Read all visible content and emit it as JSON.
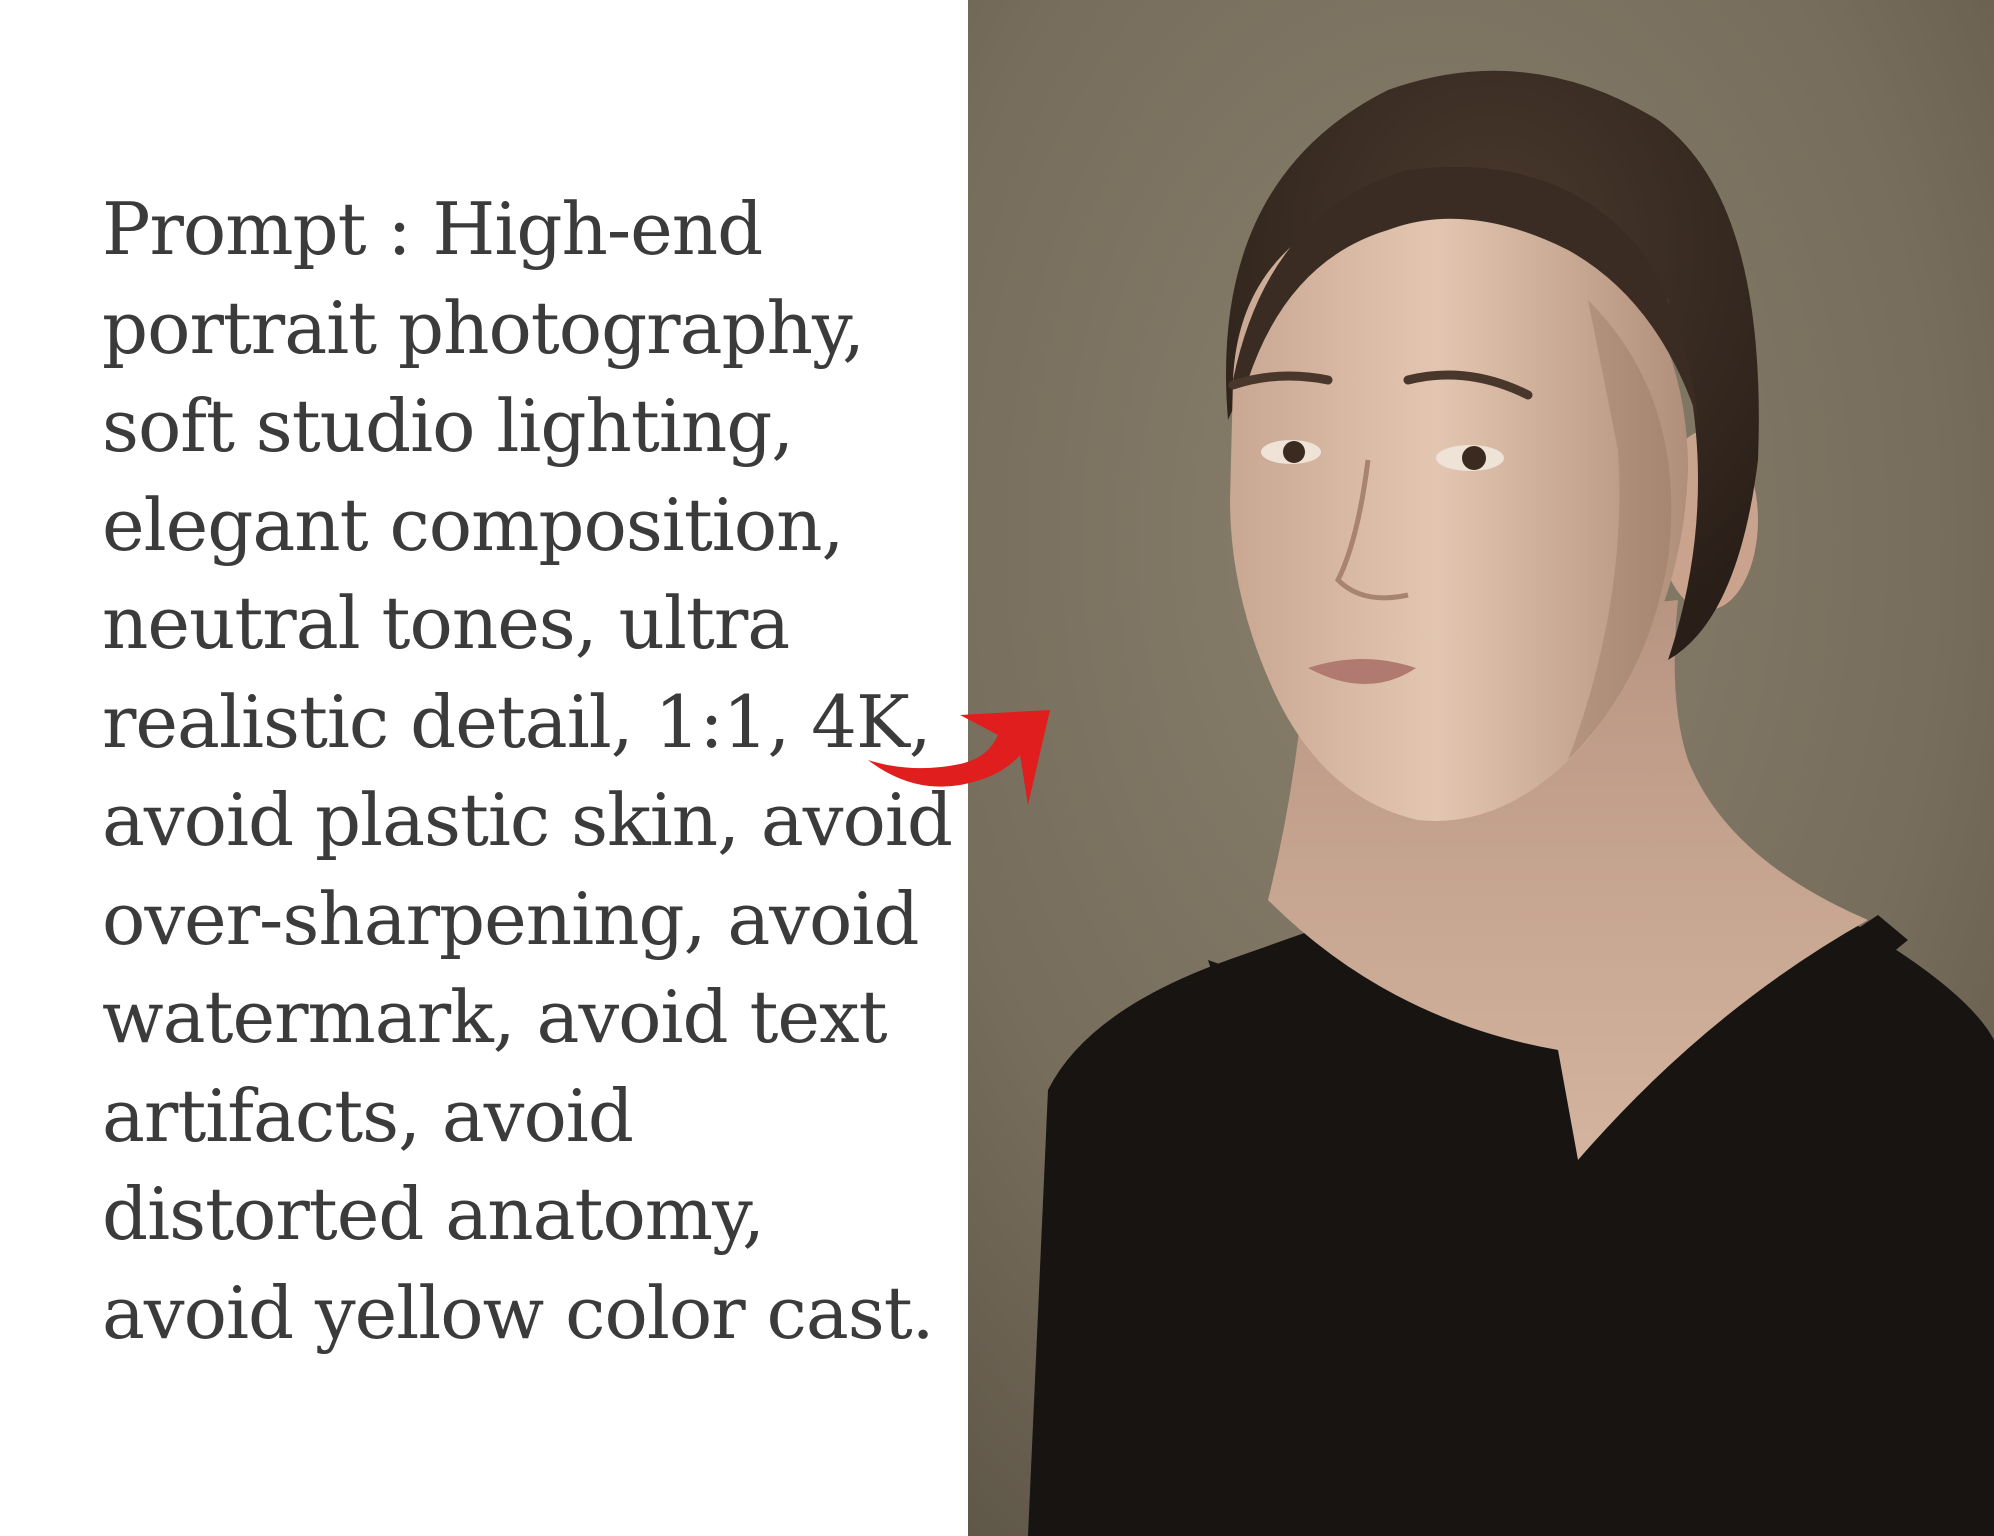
{
  "prompt": {
    "lines": [
      "Prompt : High-end",
      "portrait photography,",
      "soft studio lighting,",
      "elegant composition,",
      "neutral tones, ultra",
      "realistic detail, 1:1, 4K,",
      "avoid plastic skin, avoid",
      "over-sharpening, avoid",
      "watermark, avoid text",
      "artifacts, avoid",
      "distorted anatomy,",
      "avoid yellow color cast."
    ]
  },
  "photo": {
    "subject": "portrait-photo",
    "background_color": "#7a705f",
    "garment_color": "#171412",
    "skin_color": "#d7b8a3",
    "hair_color": "#3a2c22"
  },
  "arrow": {
    "icon": "curved-arrow-right-icon",
    "color": "#e01e1e"
  }
}
